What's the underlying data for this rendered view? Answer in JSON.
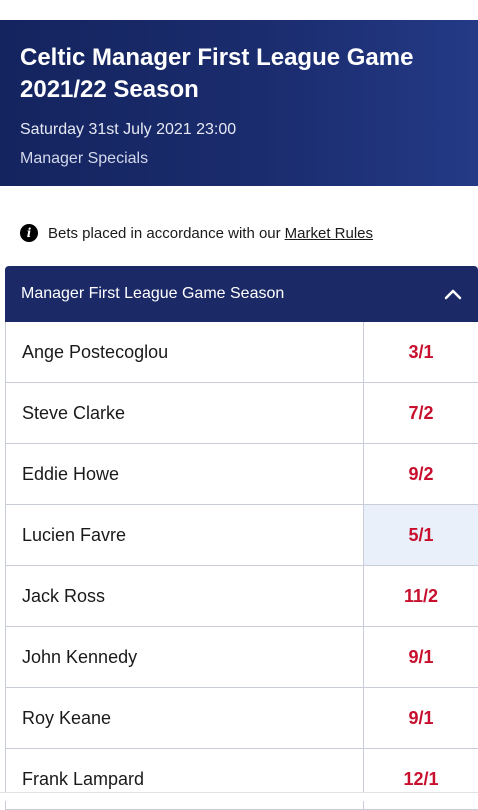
{
  "header": {
    "title": "Celtic Manager First League Game 2021/22 Season",
    "datetime": "Saturday 31st July 2021 23:00",
    "category": "Manager Specials"
  },
  "rules": {
    "icon": "info-icon",
    "text": "Bets placed in accordance with our",
    "link": "Market Rules"
  },
  "market": {
    "title": "Manager First League Game Season",
    "collapse_icon": "chevron-up-icon",
    "rows": [
      {
        "name": "Ange Postecoglou",
        "odds": "3/1"
      },
      {
        "name": "Steve Clarke",
        "odds": "7/2"
      },
      {
        "name": "Eddie Howe",
        "odds": "9/2"
      },
      {
        "name": "Lucien Favre",
        "odds": "5/1"
      },
      {
        "name": "Jack Ross",
        "odds": "11/2"
      },
      {
        "name": "John Kennedy",
        "odds": "9/1"
      },
      {
        "name": "Roy Keane",
        "odds": "9/1"
      },
      {
        "name": "Frank Lampard",
        "odds": "12/1"
      }
    ]
  },
  "colors": {
    "header_bg": "#1b2c6e",
    "odds_text": "#c8102e",
    "selected_bg": "#e9f0fa"
  }
}
